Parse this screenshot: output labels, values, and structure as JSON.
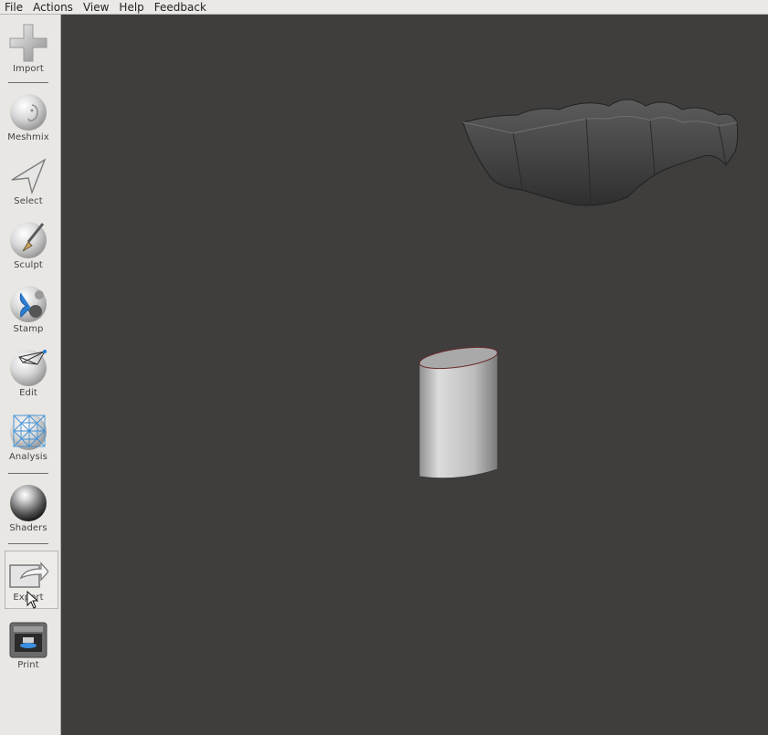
{
  "menubar": {
    "items": [
      "File",
      "Actions",
      "View",
      "Help",
      "Feedback"
    ]
  },
  "toolbar": {
    "tools": [
      {
        "label": "Import",
        "icon": "plus-icon"
      },
      {
        "label": "Meshmix",
        "icon": "meshmix-icon"
      },
      {
        "label": "Select",
        "icon": "select-arrow-icon"
      },
      {
        "label": "Sculpt",
        "icon": "sculpt-brush-icon"
      },
      {
        "label": "Stamp",
        "icon": "stamp-icon"
      },
      {
        "label": "Edit",
        "icon": "edit-icon"
      },
      {
        "label": "Analysis",
        "icon": "analysis-icon"
      },
      {
        "label": "Shaders",
        "icon": "shaders-icon"
      },
      {
        "label": "Export",
        "icon": "export-icon"
      },
      {
        "label": "Print",
        "icon": "printer-icon"
      }
    ]
  },
  "colors": {
    "viewport_bg": "#3f3e3c",
    "sidebar_bg": "#e9e7e4",
    "menubar_bg": "#ebe9e6"
  }
}
